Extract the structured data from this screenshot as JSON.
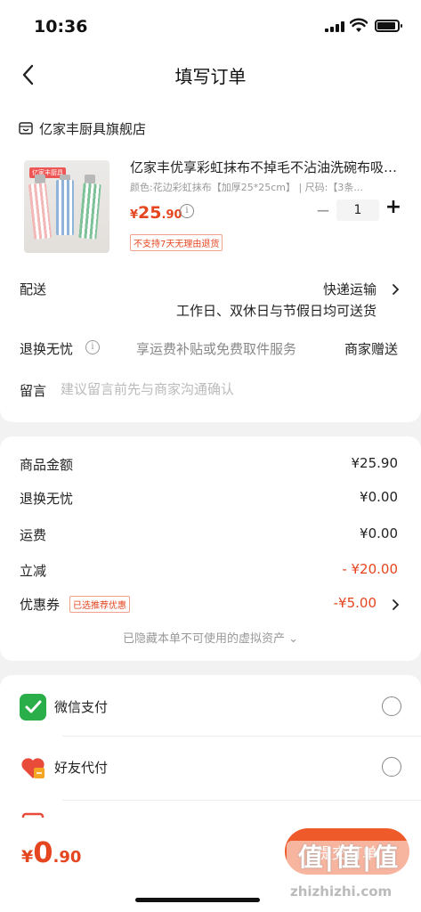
{
  "status_bar": {
    "time": "10:36"
  },
  "nav": {
    "title": "填写订单"
  },
  "store": {
    "name": "亿家丰厨具旗舰店"
  },
  "product": {
    "title": "亿家丰优享彩虹抹布不掉毛不沾油洗碗布吸水...",
    "spec": "颜色:花边彩虹抹布【加厚25*25cm】  |  尺码:【3条...",
    "price_symbol": "¥",
    "price_int": "25",
    "price_dec": ".90",
    "quantity": "1",
    "minus": "−",
    "plus": "+",
    "no_return_tag": "不支持7天无理由退货",
    "image_badge": "亿家丰厨具"
  },
  "delivery": {
    "label": "配送",
    "value": "快递运输",
    "note": "工作日、双休日与节假日均可送货"
  },
  "return_service": {
    "label": "退换无忧",
    "description": "享运费补贴或免费取件服务",
    "value": "商家赠送"
  },
  "message": {
    "label": "留言",
    "placeholder": "建议留言前先与商家沟通确认"
  },
  "summary": {
    "goods_amount_label": "商品金额",
    "goods_amount": "¥25.90",
    "return_label": "退换无忧",
    "return_amount": "¥0.00",
    "shipping_label": "运费",
    "shipping_amount": "¥0.00",
    "discount_label": "立减",
    "discount_amount": "- ¥20.00",
    "coupon_label": "优惠券",
    "coupon_tag": "已选推荐优惠",
    "coupon_amount": "-¥5.00",
    "hidden_assets": "已隐藏本单不可使用的虚拟资产 ⌄"
  },
  "payment": {
    "wechat_label": "微信支付",
    "friend_label": "好友代付"
  },
  "bottom": {
    "total_symbol": "¥",
    "total_int": "0",
    "total_dec": ".90",
    "submit_label": "提交订单",
    "watermark": "值|值|值",
    "watermark_url": "zhizhizhi.com"
  },
  "colors": {
    "accent": "#e5451f",
    "button": "#ee5a2a",
    "wechat": "#2aae4a"
  },
  "icons": [
    "back-arrow-icon",
    "store-icon",
    "info-icon",
    "chevron-right-icon",
    "wechat-pay-icon",
    "friend-pay-icon",
    "radio-icon"
  ]
}
